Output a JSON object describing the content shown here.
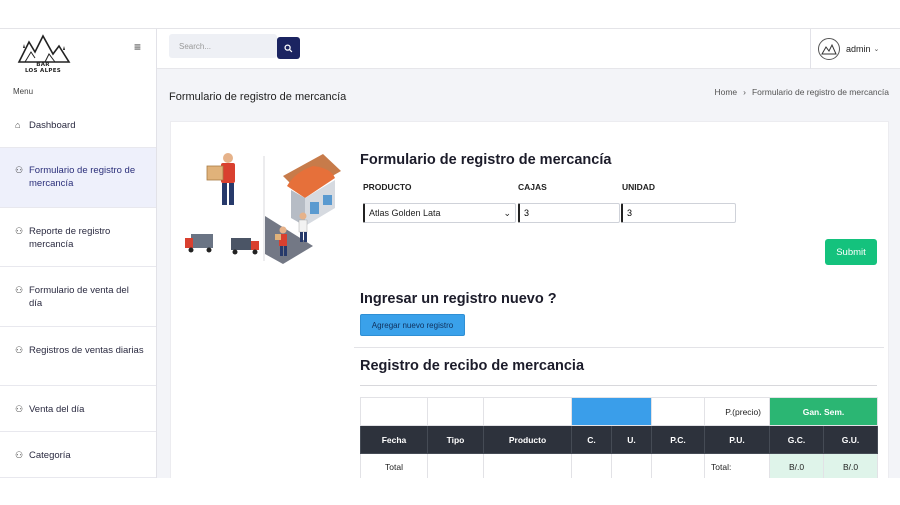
{
  "sidebar": {
    "logo_text_line1": "BAR",
    "logo_text_line2": "LOS ALPES",
    "menu_label": "Menu",
    "items": [
      {
        "label": "Dashboard",
        "icon": "home-icon"
      },
      {
        "label": "Formulario de registro de mercancía",
        "icon": "users-icon"
      },
      {
        "label": "Reporte de registro mercancía",
        "icon": "users-icon"
      },
      {
        "label": "Formulario de venta del día",
        "icon": "users-icon"
      },
      {
        "label": "Registros de ventas diarias",
        "icon": "users-icon"
      },
      {
        "label": "Venta del día",
        "icon": "users-icon"
      },
      {
        "label": "Categoría",
        "icon": "users-icon"
      }
    ]
  },
  "topbar": {
    "search_placeholder": "Search...",
    "user_name": "admin"
  },
  "page": {
    "title": "Formulario de registro de mercancía",
    "breadcrumb_home": "Home",
    "breadcrumb_sep": "›",
    "breadcrumb_current": "Formulario de registro de mercancía"
  },
  "form": {
    "title": "Formulario de registro de mercancía",
    "label_producto": "PRODUCTO",
    "label_cajas": "CAJAS",
    "label_unidad": "UNIDAD",
    "producto_value": "Atlas Golden Lata",
    "cajas_value": "3",
    "unidad_value": "3",
    "submit_label": "Submit"
  },
  "nuevo": {
    "title": "Ingresar un registro nuevo ?",
    "button_label": "Agregar nuevo registro"
  },
  "registro": {
    "title": "Registro de recibo de mercancia",
    "top_row": {
      "precio": "P.(precio)",
      "ganancia": "Gan. Sem."
    },
    "columns": [
      "Fecha",
      "Tipo",
      "Producto",
      "C.",
      "U.",
      "P.C.",
      "P.U.",
      "G.C.",
      "G.U."
    ],
    "total_row": {
      "fecha": "Total",
      "pu": "Total:",
      "gc": "B/.0",
      "gu": "B/.0"
    }
  },
  "colors": {
    "accent_dark": "#1b2461",
    "submit_green": "#14c27d",
    "blue_button": "#3aa1ea",
    "table_head": "#2d323c",
    "gan_green": "#2bb673"
  }
}
